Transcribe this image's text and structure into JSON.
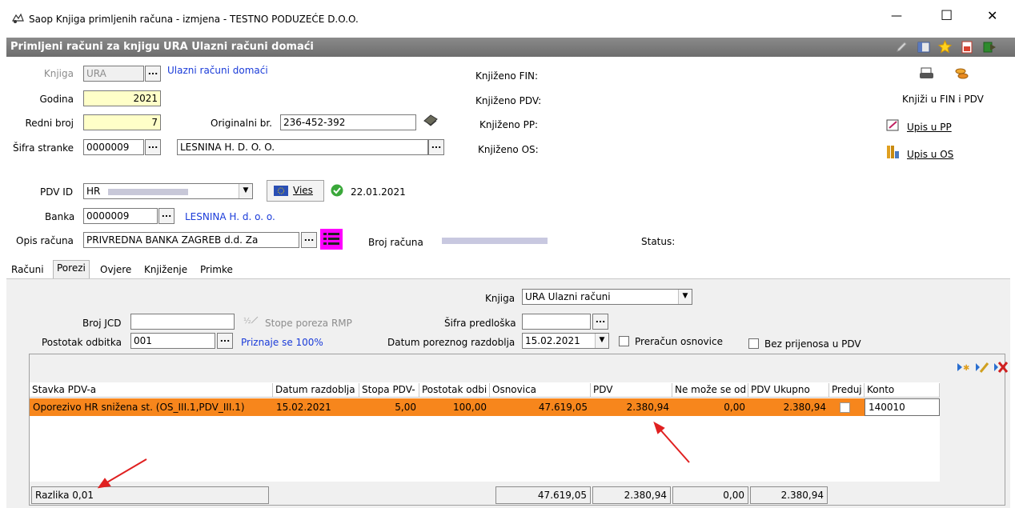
{
  "window": {
    "title": "Saop Knjiga primljenih računa - izmjena  - TESTNO PODUZEĆE D.O.O.",
    "minimize": "—",
    "maximize": "☐",
    "close": "✕"
  },
  "header": {
    "title": "Primljeni računi za knjigu URA Ulazni računi domaći"
  },
  "form": {
    "knjiga_label": "Knjiga",
    "knjiga_value": "URA",
    "knjiga_desc": "Ulazni računi domaći",
    "godina_label": "Godina",
    "godina_value": "2021",
    "redni_label": "Redni broj",
    "redni_value": "7",
    "originalni_label": "Originalni br.",
    "originalni_value": "236-452-392",
    "sifra_stranke_label": "Šifra stranke",
    "sifra_stranke_value": "0000009",
    "stranka_name": "LESNINA H. D. O. O.",
    "pdv_id_label": "PDV ID",
    "pdv_id_value": "HR",
    "vies_label": "Vies",
    "vies_date": "22.01.2021",
    "banka_label": "Banka",
    "banka_value": "0000009",
    "banka_name": "LESNINA H. d. o. o.",
    "opis_label": "Opis računa",
    "opis_value": "PRIVREDNA BANKA ZAGREB d.d. Za",
    "broj_racuna_label": "Broj računa",
    "status_label": "Status:",
    "dots": "..."
  },
  "booking": {
    "fin": "Knjiženo FIN:",
    "pdv": "Knjiženo PDV:",
    "pp": "Knjiženo PP:",
    "os": "Knjiženo OS:",
    "knjizi_label": "Knjiži u FIN i PDV",
    "upis_pp": "Upis u PP",
    "upis_os": "Upis u OS"
  },
  "tabs": [
    "Računi",
    "Porezi",
    "Ovjere",
    "Knjiženje",
    "Primke"
  ],
  "porezi": {
    "knjiga_label": "Knjiga",
    "knjiga_value": "URA Ulazni računi",
    "broj_jcd_label": "Broj JCD",
    "stope_label": "Stope poreza RMP",
    "sifra_predloska_label": "Šifra predloška",
    "postotak_label": "Postotak odbitka",
    "postotak_value": "001",
    "priznaje": "Priznaje se 100%",
    "datum_label": "Datum poreznog razdoblja",
    "datum_value": "15.02.2021",
    "preracun_label": "Preračun osnovice",
    "bez_label": "Bez prijenosa u PDV"
  },
  "table": {
    "columns": [
      "Stavka PDV-a",
      "Datum razdoblja",
      "Stopa PDV-",
      "Postotak odbi",
      "Osnovica",
      "PDV",
      "Ne može se od",
      "PDV Ukupno",
      "Preduj",
      "Konto"
    ],
    "rows": [
      [
        "Oporezivo HR snižena st. (OS_III.1,PDV_III.1)",
        "15.02.2021",
        "5,00",
        "100,00",
        "47.619,05",
        "2.380,94",
        "0,00",
        "2.380,94",
        "",
        "140010"
      ]
    ]
  },
  "footer": {
    "razlika": "Razlika 0,01",
    "osnovica": "47.619,05",
    "pdv": "2.380,94",
    "ne_moze": "0,00",
    "ukupno": "2.380,94"
  },
  "colors": {
    "header_bg": "#7a7a7a",
    "row_highlight": "#f7861c",
    "link_blue": "#1a3bd9",
    "arrow_red": "#e02020"
  }
}
